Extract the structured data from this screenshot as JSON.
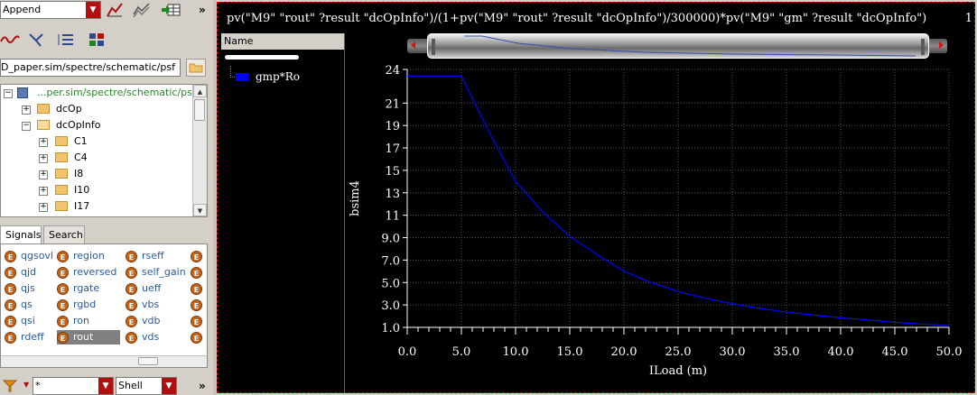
{
  "toolbar": {
    "mode_value": "Append",
    "more_label": "»"
  },
  "path": {
    "value": "D_paper.sim/spectre/schematic/psf"
  },
  "tree": {
    "root": "...per.sim/spectre/schematic/psf",
    "items": [
      {
        "label": "dcOp",
        "level": 1
      },
      {
        "label": "dcOpInfo",
        "level": 1
      },
      {
        "label": "C1",
        "level": 2
      },
      {
        "label": "C4",
        "level": 2
      },
      {
        "label": "I8",
        "level": 2
      },
      {
        "label": "I10",
        "level": 2
      },
      {
        "label": "I17",
        "level": 2
      }
    ]
  },
  "tabs": [
    "Signals",
    "Search"
  ],
  "signals": {
    "col1": [
      "qgsovl",
      "qjd",
      "qjs",
      "qs",
      "qsi",
      "rdeff"
    ],
    "col2": [
      "region",
      "reversed",
      "rgate",
      "rgbd",
      "ron",
      "rout"
    ],
    "col3": [
      "rseff",
      "self_gain",
      "ueff",
      "vbs",
      "vdb",
      "vds"
    ],
    "selected": "rout",
    "badge": "E"
  },
  "filter": {
    "value": "*",
    "shell_value": "Shell",
    "more_label": "»"
  },
  "graph": {
    "expression": "pv(\"M9\" \"rout\" ?result \"dcOpInfo\")/(1+pv(\"M9\" \"rout\" ?result \"dcOpInfo\")/300000)*pv(\"M9\" \"gm\" ?result \"dcOpInfo\")",
    "expression_suffix": "1",
    "name_header": "Name",
    "trace_color": "#0000ff"
  },
  "chart_data": {
    "type": "line",
    "title": "",
    "xlabel": "ILoad (m)",
    "ylabel": "bsim4",
    "xlim": [
      0,
      50
    ],
    "ylim": [
      1,
      24
    ],
    "xticks": [
      0,
      5,
      10,
      15,
      20,
      25,
      30,
      35,
      40,
      45,
      50
    ],
    "xtick_labels": [
      "0.0",
      "5.0",
      "10.0",
      "15.0",
      "20.0",
      "25.0",
      "30.0",
      "35.0",
      "40.0",
      "45.0",
      "50.0"
    ],
    "yticks": [
      1,
      3,
      5,
      7,
      9,
      11,
      13,
      15,
      17,
      19,
      21,
      24
    ],
    "ytick_labels": [
      "1.0",
      "3.0",
      "5.0",
      "7.0",
      "9.0",
      "11",
      "13",
      "15",
      "17",
      "19",
      "21",
      "24"
    ],
    "grid": true,
    "series": [
      {
        "name": "gmp*Ro",
        "x": [
          0,
          5,
          7.5,
          10,
          12.5,
          15,
          17.5,
          20,
          22.5,
          25,
          27.5,
          30,
          32.5,
          35,
          37.5,
          40,
          42.5,
          45,
          47.5,
          50
        ],
        "y": [
          23.4,
          23.4,
          18.5,
          14.0,
          11.3,
          9.1,
          7.5,
          6.0,
          5.0,
          4.2,
          3.6,
          3.1,
          2.7,
          2.35,
          2.1,
          1.85,
          1.65,
          1.45,
          1.3,
          1.15
        ]
      }
    ]
  }
}
